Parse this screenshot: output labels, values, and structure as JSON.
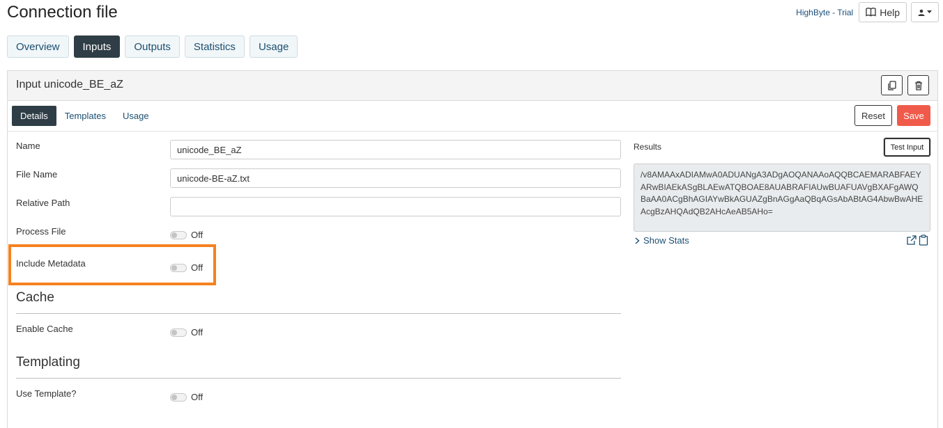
{
  "header": {
    "title": "Connection file",
    "brand": "HighByte - Trial",
    "help_label": "Help"
  },
  "main_tabs": [
    {
      "label": "Overview",
      "active": false
    },
    {
      "label": "Inputs",
      "active": true
    },
    {
      "label": "Outputs",
      "active": false
    },
    {
      "label": "Statistics",
      "active": false
    },
    {
      "label": "Usage",
      "active": false
    }
  ],
  "panel": {
    "title": "Input unicode_BE_aZ",
    "sub_tabs": [
      {
        "label": "Details",
        "active": true
      },
      {
        "label": "Templates",
        "active": false
      },
      {
        "label": "Usage",
        "active": false
      }
    ],
    "reset_label": "Reset",
    "save_label": "Save"
  },
  "form": {
    "name": {
      "label": "Name",
      "value": "unicode_BE_aZ"
    },
    "file_name": {
      "label": "File Name",
      "value": "unicode-BE-aZ.txt"
    },
    "relative_path": {
      "label": "Relative Path",
      "value": ""
    },
    "process_file": {
      "label": "Process File",
      "state": "Off"
    },
    "include_metadata": {
      "label": "Include Metadata",
      "state": "Off"
    }
  },
  "cache": {
    "title": "Cache",
    "enable_cache": {
      "label": "Enable Cache",
      "state": "Off"
    }
  },
  "templating": {
    "title": "Templating",
    "use_template": {
      "label": "Use Template?",
      "state": "Off"
    }
  },
  "results": {
    "label": "Results",
    "test_label": "Test Input",
    "output": "/v8AMAAxADIAMwA0ADUANgA3ADgAOQANAAoAQQBCAEMARABFAEYARwBIAEkASgBLAEwATQBOAE8AUABRAFIAUwBUAFUAVgBXAFgAWQBaAA0ACgBhAGIAYwBkAGUAZgBnAGgAaQBqAGsAbABtAG4AbwBwAHEAcgBzAHQAdQB2AHcAeAB5AHo=",
    "show_stats": "Show Stats"
  },
  "colors": {
    "accent_dark": "#2f3e46",
    "save": "#f05a4a",
    "highlight": "#f58220",
    "link": "#1b4f70"
  }
}
